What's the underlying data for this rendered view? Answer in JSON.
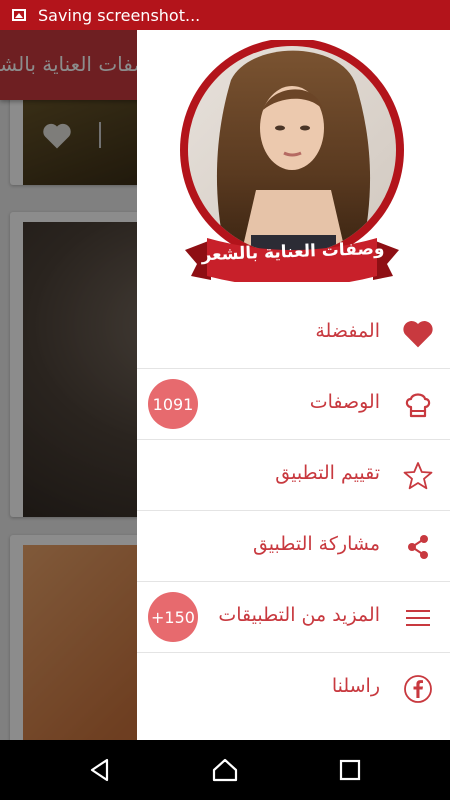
{
  "status_bar": {
    "text": "Saving screenshot..."
  },
  "app_bar": {
    "title": "وصفات العناية بالشعر"
  },
  "drawer": {
    "banner_text": "وصفات العناية بالشعر",
    "items": [
      {
        "label": "المفضلة",
        "icon": "heart-icon",
        "badge": ""
      },
      {
        "label": "الوصفات",
        "icon": "chef-hat-icon",
        "badge": "1091"
      },
      {
        "label": "تقييم التطبيق",
        "icon": "star-icon",
        "badge": ""
      },
      {
        "label": "مشاركة التطبيق",
        "icon": "share-icon",
        "badge": ""
      },
      {
        "label": "المزيد من التطبيقات",
        "icon": "menu-lines-icon",
        "badge": "+150"
      },
      {
        "label": "راسلنا",
        "icon": "facebook-icon",
        "badge": ""
      }
    ]
  },
  "colors": {
    "accent": "#c8393f",
    "status_bar": "#b3141b",
    "badge": "#e76a6e"
  },
  "cards": [
    {
      "favorited": false
    },
    {
      "favorited": true
    },
    {
      "favorited": false
    }
  ]
}
